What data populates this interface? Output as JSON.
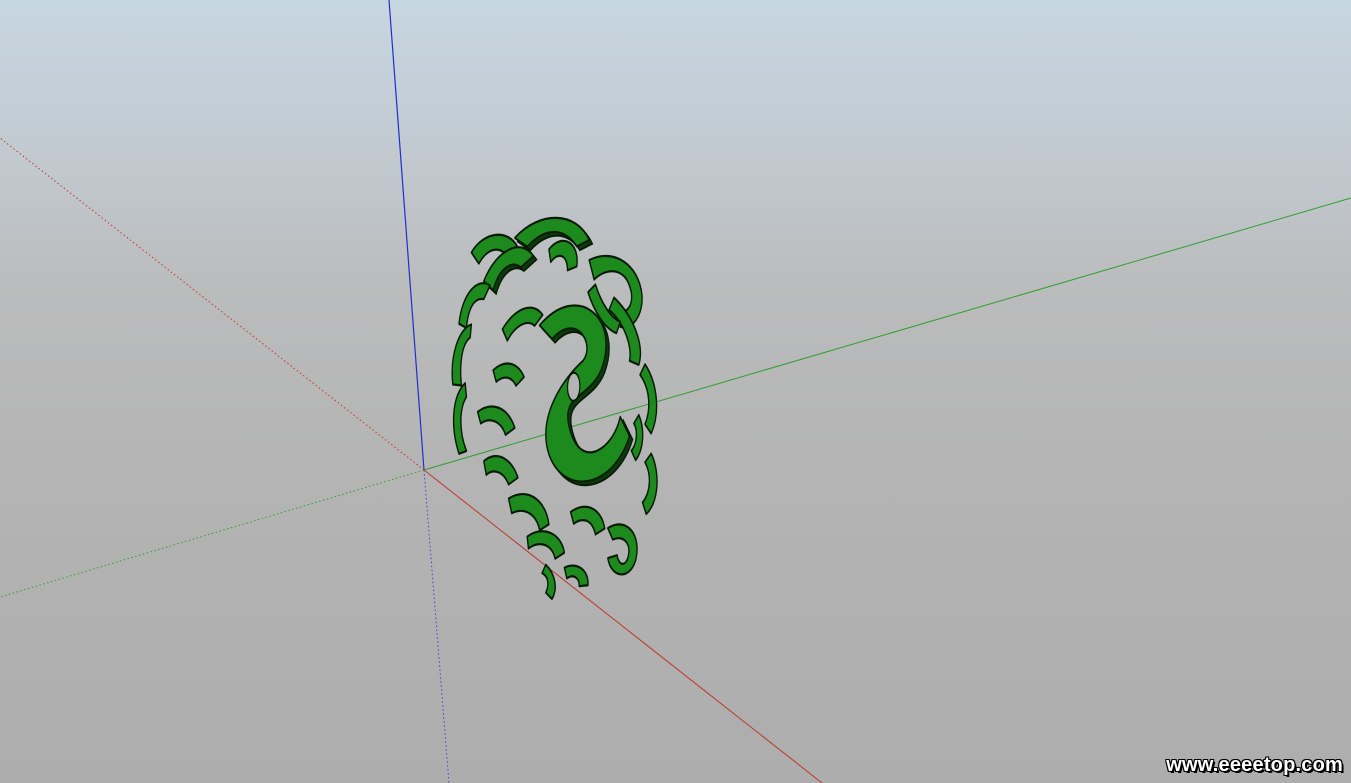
{
  "viewport": {
    "description_colors": {
      "sky_top": "#c6d6e1",
      "ground": "#b4b4b4",
      "axis_red": "#c0392b",
      "axis_green": "#2e9e2e",
      "axis_blue": "#1f2fd0",
      "model_fill": "#1d8a1d",
      "model_edge": "#0a2a0a"
    }
  },
  "model": {
    "icon": "dragon-medallion",
    "color": "#1d8a1d"
  },
  "watermark": {
    "text": "www.eeeetop.com"
  }
}
